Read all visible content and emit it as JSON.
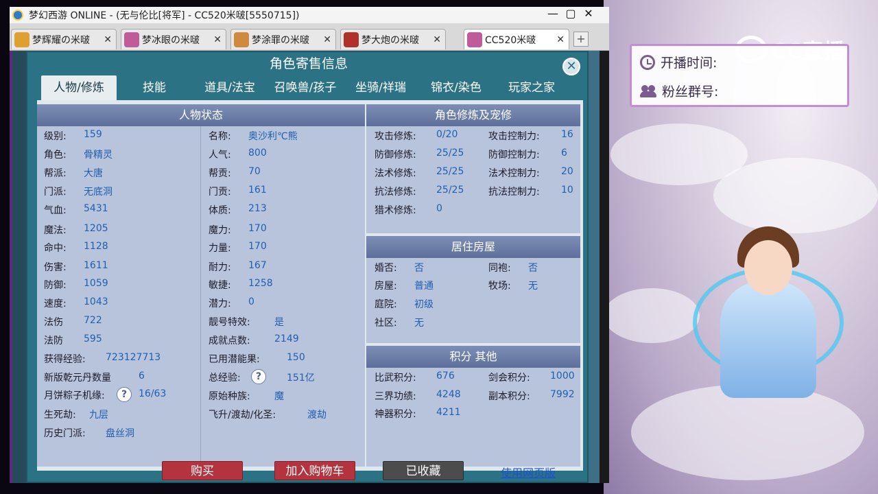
{
  "window": {
    "title": "梦幻西游 ONLINE - (无与伦比[将军] - CC520米啵[5550715])",
    "minimize": "—",
    "close": "✕"
  },
  "tabs": [
    {
      "label": "梦辉耀の米啵",
      "color": "#e0a030",
      "close": "✕"
    },
    {
      "label": "梦冰眼の米啵",
      "color": "#c05a9a",
      "close": "✕"
    },
    {
      "label": "梦涂罪の米啵",
      "color": "#d08a40",
      "close": "✕"
    },
    {
      "label": "梦大炮の米啵",
      "color": "#b0302a",
      "close": "✕"
    },
    {
      "label": "CC520米啵",
      "color": "#c05a9a",
      "close": "✕",
      "active": true
    }
  ],
  "tab_add": "+",
  "dialog": {
    "title": "角色寄售信息",
    "close": "✕",
    "tabs": [
      "人物/修炼",
      "技能",
      "道具/法宝",
      "召唤兽/孩子",
      "坐骑/祥瑞",
      "锦衣/染色",
      "玩家之家"
    ]
  },
  "status": {
    "header": "人物状态",
    "left": [
      {
        "label": "级别:",
        "value": "159"
      },
      {
        "label": "角色:",
        "value": "骨精灵"
      },
      {
        "label": "帮派:",
        "value": "大唐"
      },
      {
        "label": "门派:",
        "value": "无底洞"
      },
      {
        "label": "气血:",
        "value": "5431"
      },
      {
        "label": "魔法:",
        "value": "1205"
      },
      {
        "label": "命中:",
        "value": "1128"
      },
      {
        "label": "伤害:",
        "value": "1611"
      },
      {
        "label": "防御:",
        "value": "1059"
      },
      {
        "label": "速度:",
        "value": "1043"
      },
      {
        "label": "法伤",
        "value": "722"
      },
      {
        "label": "法防",
        "value": "595"
      },
      {
        "label": "获得经验:",
        "value": "723127713"
      },
      {
        "label": "新版乾元丹数量",
        "value": "6"
      },
      {
        "label": "月饼粽子机缘:",
        "value": "16/63"
      },
      {
        "label": "生死劫:",
        "value": "九层"
      },
      {
        "label": "历史门派:",
        "value": "盘丝洞"
      }
    ],
    "right": [
      {
        "label": "名称:",
        "value": "奥沙利℃熊"
      },
      {
        "label": "人气:",
        "value": "800"
      },
      {
        "label": "帮贡:",
        "value": "70"
      },
      {
        "label": "门贡:",
        "value": "161"
      },
      {
        "label": "体质:",
        "value": "213"
      },
      {
        "label": "魔力:",
        "value": "170"
      },
      {
        "label": "力量:",
        "value": "170"
      },
      {
        "label": "耐力:",
        "value": "167"
      },
      {
        "label": "敏捷:",
        "value": "1258"
      },
      {
        "label": "潜力:",
        "value": "0"
      },
      {
        "label": "靓号特效:",
        "value": "是"
      },
      {
        "label": "成就点数:",
        "value": "2149"
      },
      {
        "label": "已用潜能果:",
        "value": "150"
      },
      {
        "label": "总经验:",
        "value": "151亿"
      },
      {
        "label": "原始种族:",
        "value": "魔"
      },
      {
        "label": "飞升/渡劫/化圣:",
        "value": "渡劫"
      }
    ],
    "qmark": "?"
  },
  "cultivation": {
    "header": "角色修炼及宠修",
    "left": [
      {
        "label": "攻击修炼:",
        "value": "0/20"
      },
      {
        "label": "防御修炼:",
        "value": "25/25"
      },
      {
        "label": "法术修炼:",
        "value": "25/25"
      },
      {
        "label": "抗法修炼:",
        "value": "25/25"
      },
      {
        "label": "猎术修炼:",
        "value": "0"
      }
    ],
    "right": [
      {
        "label": "攻击控制力:",
        "value": "16"
      },
      {
        "label": "防御控制力:",
        "value": "6"
      },
      {
        "label": "法术控制力:",
        "value": "20"
      },
      {
        "label": "抗法控制力:",
        "value": "10"
      }
    ]
  },
  "housing": {
    "header": "居住房屋",
    "left": [
      {
        "label": "婚否:",
        "value": "否"
      },
      {
        "label": "房屋:",
        "value": "普通"
      },
      {
        "label": "庭院:",
        "value": "初级"
      },
      {
        "label": "社区:",
        "value": "无"
      }
    ],
    "right": [
      {
        "label": "同袍:",
        "value": "否"
      },
      {
        "label": "牧场:",
        "value": "无"
      }
    ]
  },
  "points": {
    "header": "积分 其他",
    "left": [
      {
        "label": "比武积分:",
        "value": "676"
      },
      {
        "label": "三界功绩:",
        "value": "4248"
      },
      {
        "label": "神器积分:",
        "value": "4211"
      }
    ],
    "right": [
      {
        "label": "剑会积分:",
        "value": "1000"
      },
      {
        "label": "副本积分:",
        "value": "7992"
      }
    ]
  },
  "buttons": {
    "buy": "购买",
    "cart": "加入购物车",
    "favorited": "已收藏",
    "web": "使用网页版"
  },
  "stream": {
    "logo": "CC直播",
    "start_time_label": "开播时间:",
    "fan_group_label": "粉丝群号:"
  }
}
